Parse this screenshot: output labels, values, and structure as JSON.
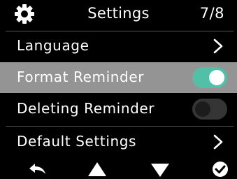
{
  "header": {
    "title": "Settings",
    "page": "7/8",
    "icon": "gear-icon"
  },
  "menu": {
    "items": [
      {
        "label": "Language",
        "control": "chevron-right-icon"
      },
      {
        "label": "Format Reminder",
        "control": "toggle",
        "state": "on",
        "selected": true
      },
      {
        "label": "Deleting Reminder",
        "control": "toggle",
        "state": "off"
      },
      {
        "label": "Default Settings",
        "control": "chevron-right-icon"
      }
    ]
  },
  "nav": {
    "buttons": [
      "back-arrow-icon",
      "up-triangle-icon",
      "down-triangle-icon",
      "confirm-check-icon"
    ]
  },
  "colors": {
    "background": "#000000",
    "selected_row": "#949494",
    "toggle_on": "#52c0a6",
    "toggle_off": "#353535"
  }
}
